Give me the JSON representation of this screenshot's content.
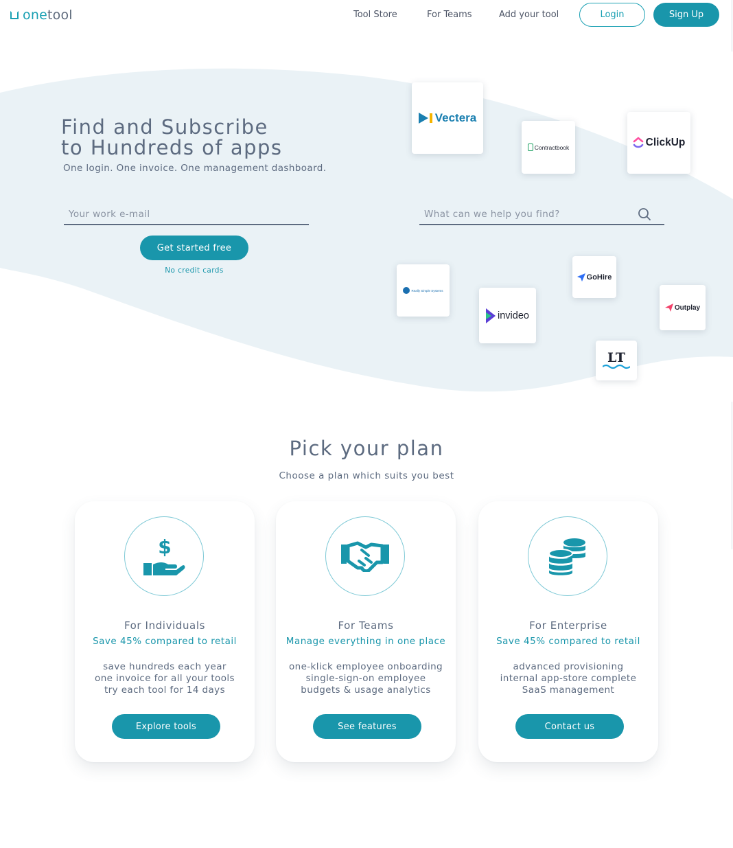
{
  "brand": {
    "name_part1": "one",
    "name_part2": "tool"
  },
  "nav": {
    "tool_store": "Tool Store",
    "for_teams": "For Teams",
    "add_tool": "Add your tool",
    "login": "Login",
    "signup": "Sign Up"
  },
  "hero": {
    "title_line1": "Find and Subscribe",
    "title_line2": "to Hundreds of apps",
    "subtitle": "One login. One invoice. One management dashboard.",
    "email_placeholder": "Your work e-mail",
    "search_placeholder": "What can we help you find?",
    "cta": "Get started free",
    "cta_note": "No credit cards"
  },
  "apps": [
    {
      "name": "Vectera",
      "color": "#1a7fb0"
    },
    {
      "name": "Contractbook",
      "color": "#1f2330"
    },
    {
      "name": "ClickUp",
      "color": "#1f2330"
    },
    {
      "name": "Really Simple Systems",
      "color": "#1a6fb0"
    },
    {
      "name": "invideo",
      "color": "#1f2330"
    },
    {
      "name": "GoHire",
      "color": "#1f2330"
    },
    {
      "name": "Outplay",
      "color": "#1f2330"
    },
    {
      "name": "LT",
      "color": "#1f2330"
    }
  ],
  "plans": {
    "title": "Pick your plan",
    "subtitle": "Choose a plan which suits you best",
    "items": [
      {
        "name": "For Individuals",
        "tagline": "Save 45% compared to retail",
        "features": [
          "save hundreds each year",
          "one invoice for all your tools",
          "try each tool for 14 days"
        ],
        "button": "Explore tools",
        "icon": "hand-dollar-icon"
      },
      {
        "name": "For Teams",
        "tagline": "Manage everything in one place",
        "features": [
          "one-klick employee onboarding",
          "single-sign-on employee",
          "budgets & usage analytics"
        ],
        "button": "See features",
        "icon": "handshake-icon"
      },
      {
        "name": "For Enterprise",
        "tagline": "Save 45% compared to retail",
        "features": [
          "advanced provisioning",
          "internal app-store complete",
          "SaaS management"
        ],
        "button": "Contact us",
        "icon": "coins-icon"
      }
    ]
  },
  "colors": {
    "accent": "#1996ab",
    "text": "#5d6b80",
    "hero_wave": "#eaf2f6"
  }
}
